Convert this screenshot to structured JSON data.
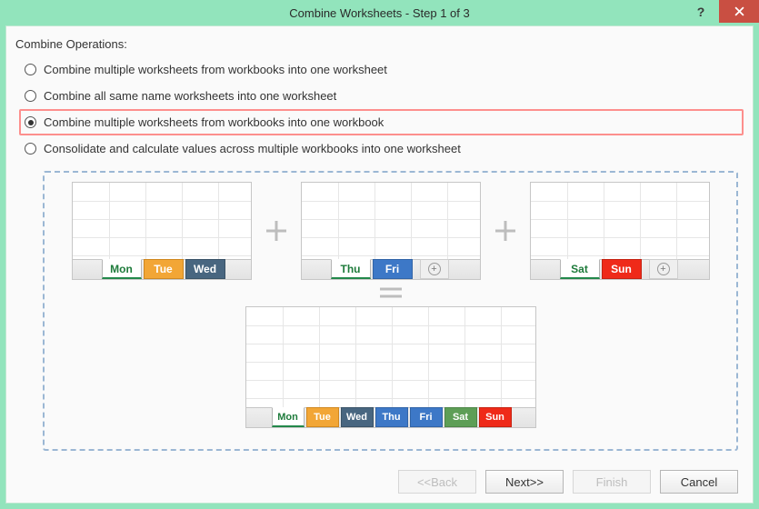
{
  "title": "Combine Worksheets - Step 1 of 3",
  "group_label": "Combine Operations:",
  "options": [
    {
      "label": "Combine multiple worksheets from workbooks into one worksheet",
      "checked": false,
      "highlight": false
    },
    {
      "label": "Combine all same name worksheets into one worksheet",
      "checked": false,
      "highlight": false
    },
    {
      "label": "Combine multiple worksheets from workbooks into one workbook",
      "checked": true,
      "highlight": true
    },
    {
      "label": "Consolidate and calculate values across multiple workbooks into one worksheet",
      "checked": false,
      "highlight": false
    }
  ],
  "preview": {
    "wb1_tabs": [
      {
        "label": "Mon",
        "style": "active"
      },
      {
        "label": "Tue",
        "style": "orange"
      },
      {
        "label": "Wed",
        "style": "darkblue"
      }
    ],
    "wb2_tabs": [
      {
        "label": "Thu",
        "style": "active"
      },
      {
        "label": "Fri",
        "style": "blue"
      }
    ],
    "wb3_tabs": [
      {
        "label": "Sat",
        "style": "active"
      },
      {
        "label": "Sun",
        "style": "red"
      }
    ],
    "result_tabs": [
      {
        "label": "Mon",
        "style": "active"
      },
      {
        "label": "Tue",
        "style": "orange"
      },
      {
        "label": "Wed",
        "style": "darkblue"
      },
      {
        "label": "Thu",
        "style": "blue"
      },
      {
        "label": "Fri",
        "style": "blue"
      },
      {
        "label": "Sat",
        "style": "green"
      },
      {
        "label": "Sun",
        "style": "red"
      }
    ]
  },
  "footer": {
    "back": "<<Back",
    "next": "Next>>",
    "finish": "Finish",
    "cancel": "Cancel"
  }
}
